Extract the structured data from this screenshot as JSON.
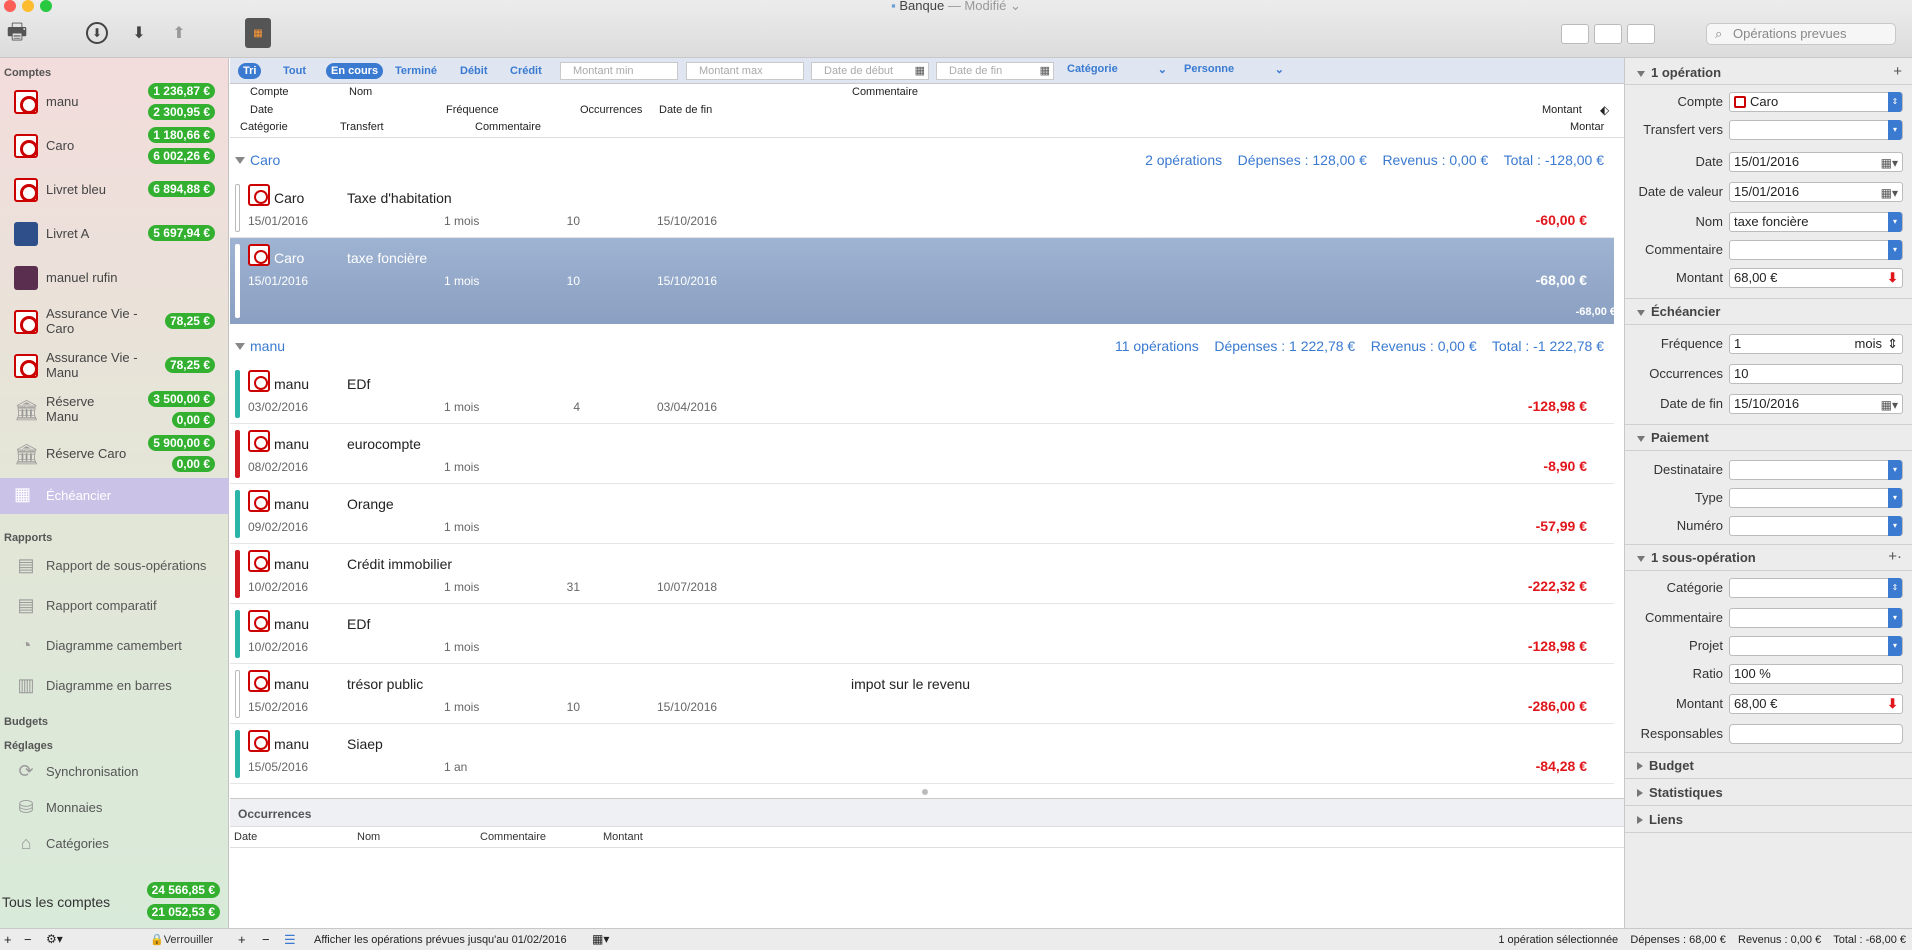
{
  "window": {
    "title": "Banque",
    "subtitle": "— Modifié"
  },
  "toolbar": {
    "search_placeholder": "Opérations prevues"
  },
  "sidebar": {
    "comptes_title": "Comptes",
    "accounts": [
      {
        "name": "manu",
        "balances": [
          "1 236,87 €",
          "2 300,95 €"
        ],
        "icon": "bank-icon"
      },
      {
        "name": "Caro",
        "balances": [
          "1 180,66 €",
          "6 002,26 €"
        ],
        "icon": "bank-icon"
      },
      {
        "name": "Livret bleu",
        "balances": [
          "6 894,88 €"
        ],
        "icon": "bank-icon"
      },
      {
        "name": "Livret A",
        "balances": [
          "5 697,94 €"
        ],
        "icon": "passbook-icon"
      },
      {
        "name": "manuel rufin",
        "balances": [],
        "icon": "wallet-icon"
      },
      {
        "name": "Assurance Vie - Caro",
        "balances": [
          "78,25 €"
        ],
        "icon": "bank-icon"
      },
      {
        "name": "Assurance Vie - Manu",
        "balances": [
          "78,25 €"
        ],
        "icon": "bank-icon"
      },
      {
        "name": "Réserve Manu",
        "balances": [
          "3 500,00 €",
          "0,00 €"
        ],
        "icon": "building-icon"
      },
      {
        "name": "Réserve Caro",
        "balances": [
          "5 900,00 €",
          "0,00 €"
        ],
        "icon": "building-icon"
      }
    ],
    "scheduler": "Échéancier",
    "rapports_title": "Rapports",
    "reports": [
      "Rapport de sous-opérations",
      "Rapport comparatif",
      "Diagramme camembert",
      "Diagramme en barres"
    ],
    "budgets_title": "Budgets",
    "settings_title": "Réglages",
    "settings": [
      "Synchronisation",
      "Monnaies",
      "Catégories"
    ],
    "total_label": "Tous les comptes",
    "total_balances": [
      "24 566,85 €",
      "21 052,53 €"
    ],
    "lock_label": "Verrouiller"
  },
  "filters": {
    "tri": "Tri",
    "tout": "Tout",
    "en_cours": "En cours",
    "termine": "Terminé",
    "debit": "Débit",
    "credit": "Crédit",
    "montant_min": "Montant min",
    "montant_max": "Montant max",
    "date_debut": "Date de début",
    "date_fin": "Date de fin",
    "categorie": "Catégorie",
    "personne": "Personne"
  },
  "columns": {
    "compte": "Compte",
    "nom": "Nom",
    "commentaire": "Commentaire",
    "date": "Date",
    "frequence": "Fréquence",
    "occurrences": "Occurrences",
    "date_fin": "Date de fin",
    "montant": "Montant",
    "categorie": "Catégorie",
    "transfert": "Transfert",
    "commentaire2": "Commentaire",
    "montant2": "Montar"
  },
  "groups": [
    {
      "name": "Caro",
      "summary": "2 opérations    Dépenses : 128,00 €    Revenus : 0,00 €    Total : -128,00 €"
    },
    {
      "name": "manu",
      "summary": "11 opérations    Dépenses : 1 222,78 €    Revenus : 0,00 €    Total : -1 222,78 €"
    }
  ],
  "rows": [
    {
      "account": "Caro",
      "name": "Taxe d'habitation",
      "comment": "",
      "date": "15/01/2016",
      "freq": "1 mois",
      "occ": "10",
      "end": "15/10/2016",
      "amount": "-60,00 €",
      "bar": ""
    },
    {
      "account": "Caro",
      "name": "taxe foncière",
      "comment": "",
      "date": "15/01/2016",
      "freq": "1 mois",
      "occ": "10",
      "end": "15/10/2016",
      "amount": "-68,00 €",
      "sub_amount": "-68,00 €",
      "bar": "#ffffff"
    },
    {
      "account": "manu",
      "name": "EDf",
      "comment": "",
      "date": "03/02/2016",
      "freq": "1 mois",
      "occ": "4",
      "end": "03/04/2016",
      "amount": "-128,98 €",
      "bar": "#2bb5a8"
    },
    {
      "account": "manu",
      "name": "eurocompte",
      "comment": "",
      "date": "08/02/2016",
      "freq": "1 mois",
      "occ": "",
      "end": "",
      "amount": "-8,90 €",
      "bar": "#d21a22"
    },
    {
      "account": "manu",
      "name": "Orange",
      "comment": "",
      "date": "09/02/2016",
      "freq": "1 mois",
      "occ": "",
      "end": "",
      "amount": "-57,99 €",
      "bar": "#2bb5a8"
    },
    {
      "account": "manu",
      "name": "Crédit immobilier",
      "comment": "",
      "date": "10/02/2016",
      "freq": "1 mois",
      "occ": "31",
      "end": "10/07/2018",
      "amount": "-222,32 €",
      "bar": "#d21a22"
    },
    {
      "account": "manu",
      "name": "EDf",
      "comment": "",
      "date": "10/02/2016",
      "freq": "1 mois",
      "occ": "",
      "end": "",
      "amount": "-128,98 €",
      "bar": "#2bb5a8"
    },
    {
      "account": "manu",
      "name": "trésor public",
      "comment": "impot sur le revenu",
      "date": "15/02/2016",
      "freq": "1 mois",
      "occ": "10",
      "end": "15/10/2016",
      "amount": "-286,00 €",
      "bar": ""
    },
    {
      "account": "manu",
      "name": "Siaep",
      "comment": "",
      "date": "15/05/2016",
      "freq": "1 an",
      "occ": "",
      "end": "",
      "amount": "-84,28 €",
      "bar": "#2bb5a8"
    }
  ],
  "occurrences": {
    "title": "Occurrences",
    "cols": [
      "Date",
      "Nom",
      "Commentaire",
      "Montant"
    ]
  },
  "bottom": {
    "display_text": "Afficher les opérations prévues jusqu'au 01/02/2016",
    "status": "1 opération sélectionnée    Dépenses : 68,00 €    Revenus : 0,00 €    Total : -68,00 €"
  },
  "inspector": {
    "section_op": "1 opération",
    "compte_label": "Compte",
    "compte_value": "Caro",
    "transfert_label": "Transfert vers",
    "transfert_value": "",
    "date_label": "Date",
    "date_value": "15/01/2016",
    "date_valeur_label": "Date de valeur",
    "date_valeur_value": "15/01/2016",
    "nom_label": "Nom",
    "nom_value": "taxe foncière",
    "commentaire_label": "Commentaire",
    "commentaire_value": "",
    "montant_label": "Montant",
    "montant_value": "68,00 €",
    "section_sched": "Échéancier",
    "frequence_label": "Fréquence",
    "frequence_value": "1",
    "frequence_unit": "mois",
    "occurrences_label": "Occurrences",
    "occurrences_value": "10",
    "date_fin_label": "Date de fin",
    "date_fin_value": "15/10/2016",
    "section_pay": "Paiement",
    "destinataire_label": "Destinataire",
    "type_label": "Type",
    "numero_label": "Numéro",
    "section_sub": "1 sous-opération",
    "categorie_label": "Catégorie",
    "sub_commentaire_label": "Commentaire",
    "projet_label": "Projet",
    "ratio_label": "Ratio",
    "ratio_value": "100 %",
    "sub_montant_label": "Montant",
    "sub_montant_value": "68,00 €",
    "responsables_label": "Responsables",
    "section_budget": "Budget",
    "section_stats": "Statistiques",
    "section_links": "Liens"
  }
}
